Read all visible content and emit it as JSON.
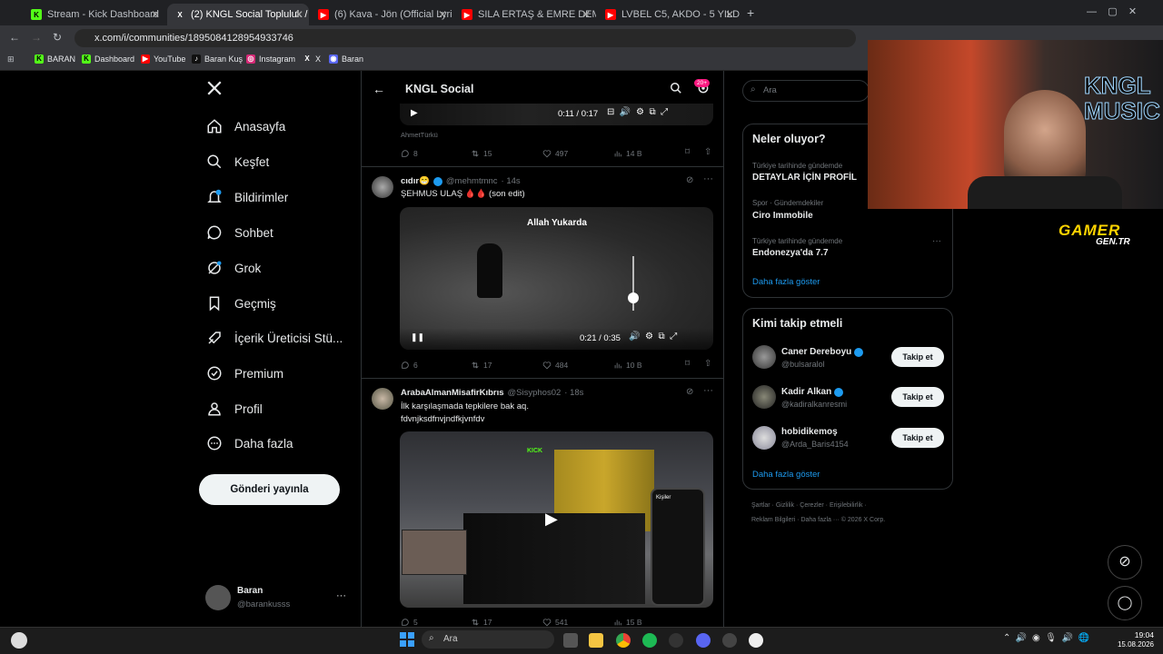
{
  "browser": {
    "tabs": [
      {
        "title": "Stream - Kick Dashboard"
      },
      {
        "title": "(2) KNGL Social Topluluk / X"
      },
      {
        "title": "(6) Kava - Jön (Official Lyric Vid..."
      },
      {
        "title": "SILA ERTAŞ & EMRE DEMİR - Y..."
      },
      {
        "title": "LVBEL C5, AKDO - 5 YILDIZ - Yo..."
      }
    ],
    "url": "x.com/i/communities/1895084128954933746",
    "bookmarks": [
      "BARAN",
      "Dashboard",
      "YouTube",
      "Baran Kuş",
      "Instagram",
      "X",
      "Baran"
    ]
  },
  "sidebar": {
    "nav": [
      {
        "label": "Anasayfa",
        "icon": "home-icon"
      },
      {
        "label": "Keşfet",
        "icon": "search-icon"
      },
      {
        "label": "Bildirimler",
        "icon": "bell-icon",
        "badge": "2"
      },
      {
        "label": "Sohbet",
        "icon": "chat-icon"
      },
      {
        "label": "Grok",
        "icon": "grok-icon"
      },
      {
        "label": "Geçmiş",
        "icon": "bookmark-icon"
      },
      {
        "label": "İçerik Üreticisi Stü...",
        "icon": "rocket-icon"
      },
      {
        "label": "Premium",
        "icon": "premium-icon"
      },
      {
        "label": "Profil",
        "icon": "person-icon"
      },
      {
        "label": "Daha fazla",
        "icon": "more-circle-icon"
      }
    ],
    "post_button": "Gönderi yayınla",
    "user": {
      "name": "Baran",
      "handle": "@barankusss"
    }
  },
  "header": {
    "title": "KNGL Social",
    "badge": "20+"
  },
  "posts": [
    {
      "video_time": "0:11 / 0:17",
      "caption_small": "AhmetTürkü",
      "stats": {
        "replies": "8",
        "reposts": "15",
        "likes": "497",
        "views": "14 B"
      }
    },
    {
      "author": "cıdır😁",
      "handle": "@mehmtmnc",
      "time": "· 14s",
      "text": "ŞEHMUS ULAŞ 🩸🩸 (son edit)",
      "video_overlay": "Allah Yukarda",
      "video_time": "0:21 / 0:35",
      "stats": {
        "replies": "6",
        "reposts": "17",
        "likes": "484",
        "views": "10 B"
      }
    },
    {
      "author": "ArabaAlmanMisafirKıbrıs",
      "handle": "@Sisyphos02",
      "time": "· 18s",
      "text_line1": "İlk karşılaşmada tepkilere bak aq.",
      "text_line2": "fdvnjksdfnvjndfkjvnfdv",
      "stats": {
        "replies": "5",
        "reposts": "17",
        "likes": "541",
        "views": "15 B"
      },
      "video_overlay": {
        "stream_badge": "KICK",
        "phone_title": "Kişiler"
      }
    }
  ],
  "search": {
    "placeholder": "Ara"
  },
  "trends": {
    "title": "Neler oluyor?",
    "items": [
      {
        "meta": "Türkiye tarihinde gündemde",
        "name": "DETAYLAR İÇİN PROFİL"
      },
      {
        "meta": "Spor · Gündemdekiler",
        "name": "Ciro Immobile"
      },
      {
        "meta": "Türkiye tarihinde gündemde",
        "name": "Endonezya'da 7.7"
      }
    ],
    "show_more": "Daha fazla göster"
  },
  "who_to_follow": {
    "title": "Kimi takip etmeli",
    "users": [
      {
        "name": "Caner Dereboyu",
        "handle": "@bulsaralol",
        "verified": true
      },
      {
        "name": "Kadir Alkan",
        "handle": "@kadiralkanresmi",
        "verified": true
      },
      {
        "name": "hobidikemoş",
        "handle": "@Arda_Baris4154",
        "verified": false
      }
    ],
    "follow_label": "Takip et",
    "show_more": "Daha fazla göster"
  },
  "footer": {
    "line1": "Şartlar · Gizlilik · Çerezler · Erişilebilirlik ·",
    "line2": "Reklam Bilgileri · Daha fazla ··· © 2026 X Corp."
  },
  "overlay": {
    "brand": "KNGL MUSIC",
    "watermark": "GAMER",
    "watermark_sub": "GEN.TR"
  },
  "taskbar": {
    "search": "Ara",
    "time": "19:04",
    "date": "15.08.2026"
  },
  "colors": {
    "accent": "#1d9bf0",
    "background": "#000000",
    "kick": "#53fc18"
  }
}
